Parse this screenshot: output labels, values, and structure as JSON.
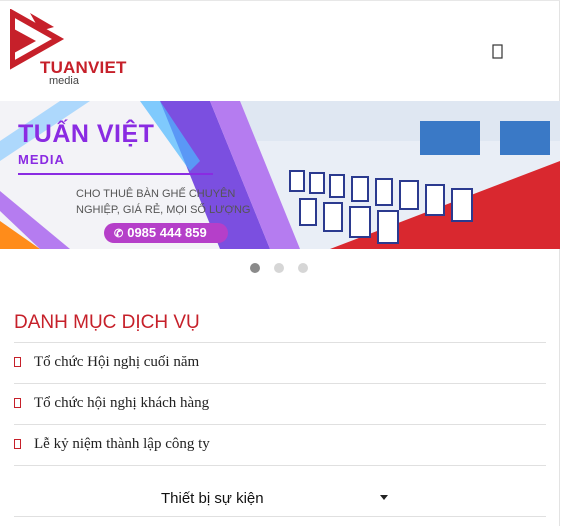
{
  "header": {
    "logo_name": "TUANVIET",
    "logo_sub": "media",
    "menu_icon": "menu-icon"
  },
  "banner": {
    "brand_line1": "TUẤN VIỆT",
    "brand_line2": "MEDIA",
    "tagline": "CHO THUÊ BÀN GHẾ CHUYÊN NGHIỆP, GIÁ RẺ, MỌI SỐ LƯỢNG",
    "phone": "0985 444 859",
    "phone_icon": "phone-icon"
  },
  "carousel": {
    "active_index": 0,
    "count": 3
  },
  "services": {
    "title": "DANH MỤC DỊCH VỤ",
    "items": [
      {
        "label": "Tổ chức Hội nghị cuối năm"
      },
      {
        "label": "Tổ chức hội nghị khách hàng"
      },
      {
        "label": "Lễ kỷ niệm thành lập công ty"
      }
    ]
  },
  "dropdown": {
    "label": "Thiết bị sự kiện",
    "icon": "caret-down-icon"
  },
  "colors": {
    "brand_red": "#c6202a",
    "brand_purple": "#8a2be2",
    "pill_purple": "#b53fc9"
  }
}
